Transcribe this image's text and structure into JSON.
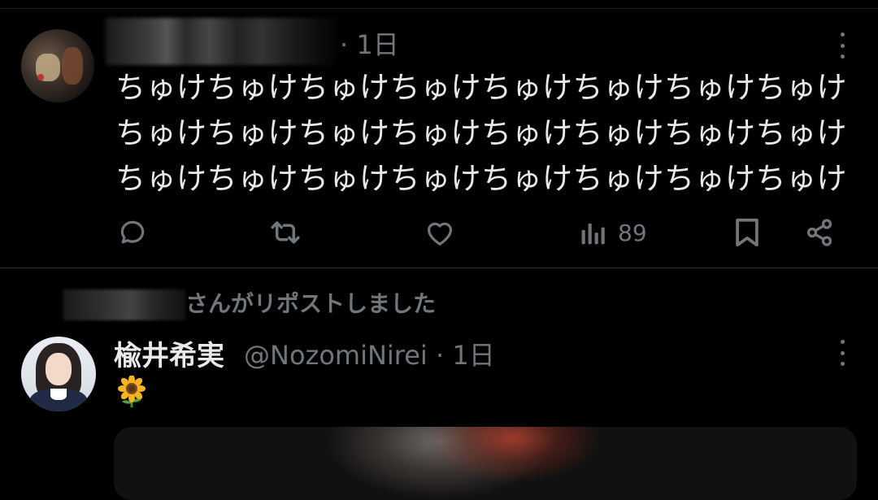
{
  "tweet1": {
    "time": "· 1日",
    "text_lines": [
      "ちゅけちゅけちゅけちゅけちゅけちゅけちゅけちゅけ",
      "ちゅけちゅけちゅけちゅけちゅけちゅけちゅけちゅけ",
      "ちゅけちゅけちゅけちゅけちゅけちゅけちゅけちゅけ"
    ],
    "actions": {
      "reply_icon": "reply-icon",
      "retweet_icon": "retweet-icon",
      "like_icon": "heart-icon",
      "views_icon": "views-icon",
      "views_count": "89",
      "bookmark_icon": "bookmark-icon",
      "share_icon": "share-icon"
    }
  },
  "retweet_header": {
    "label": "さんがリポストしました"
  },
  "tweet2": {
    "display_name": "楡井希実",
    "handle_time": "@NozomiNirei · 1日",
    "emoji": "sunflower-emoji"
  },
  "colors": {
    "background": "#000000",
    "primary_text": "#e7e9ea",
    "secondary_text": "#71767b",
    "divider": "#2f3336"
  }
}
